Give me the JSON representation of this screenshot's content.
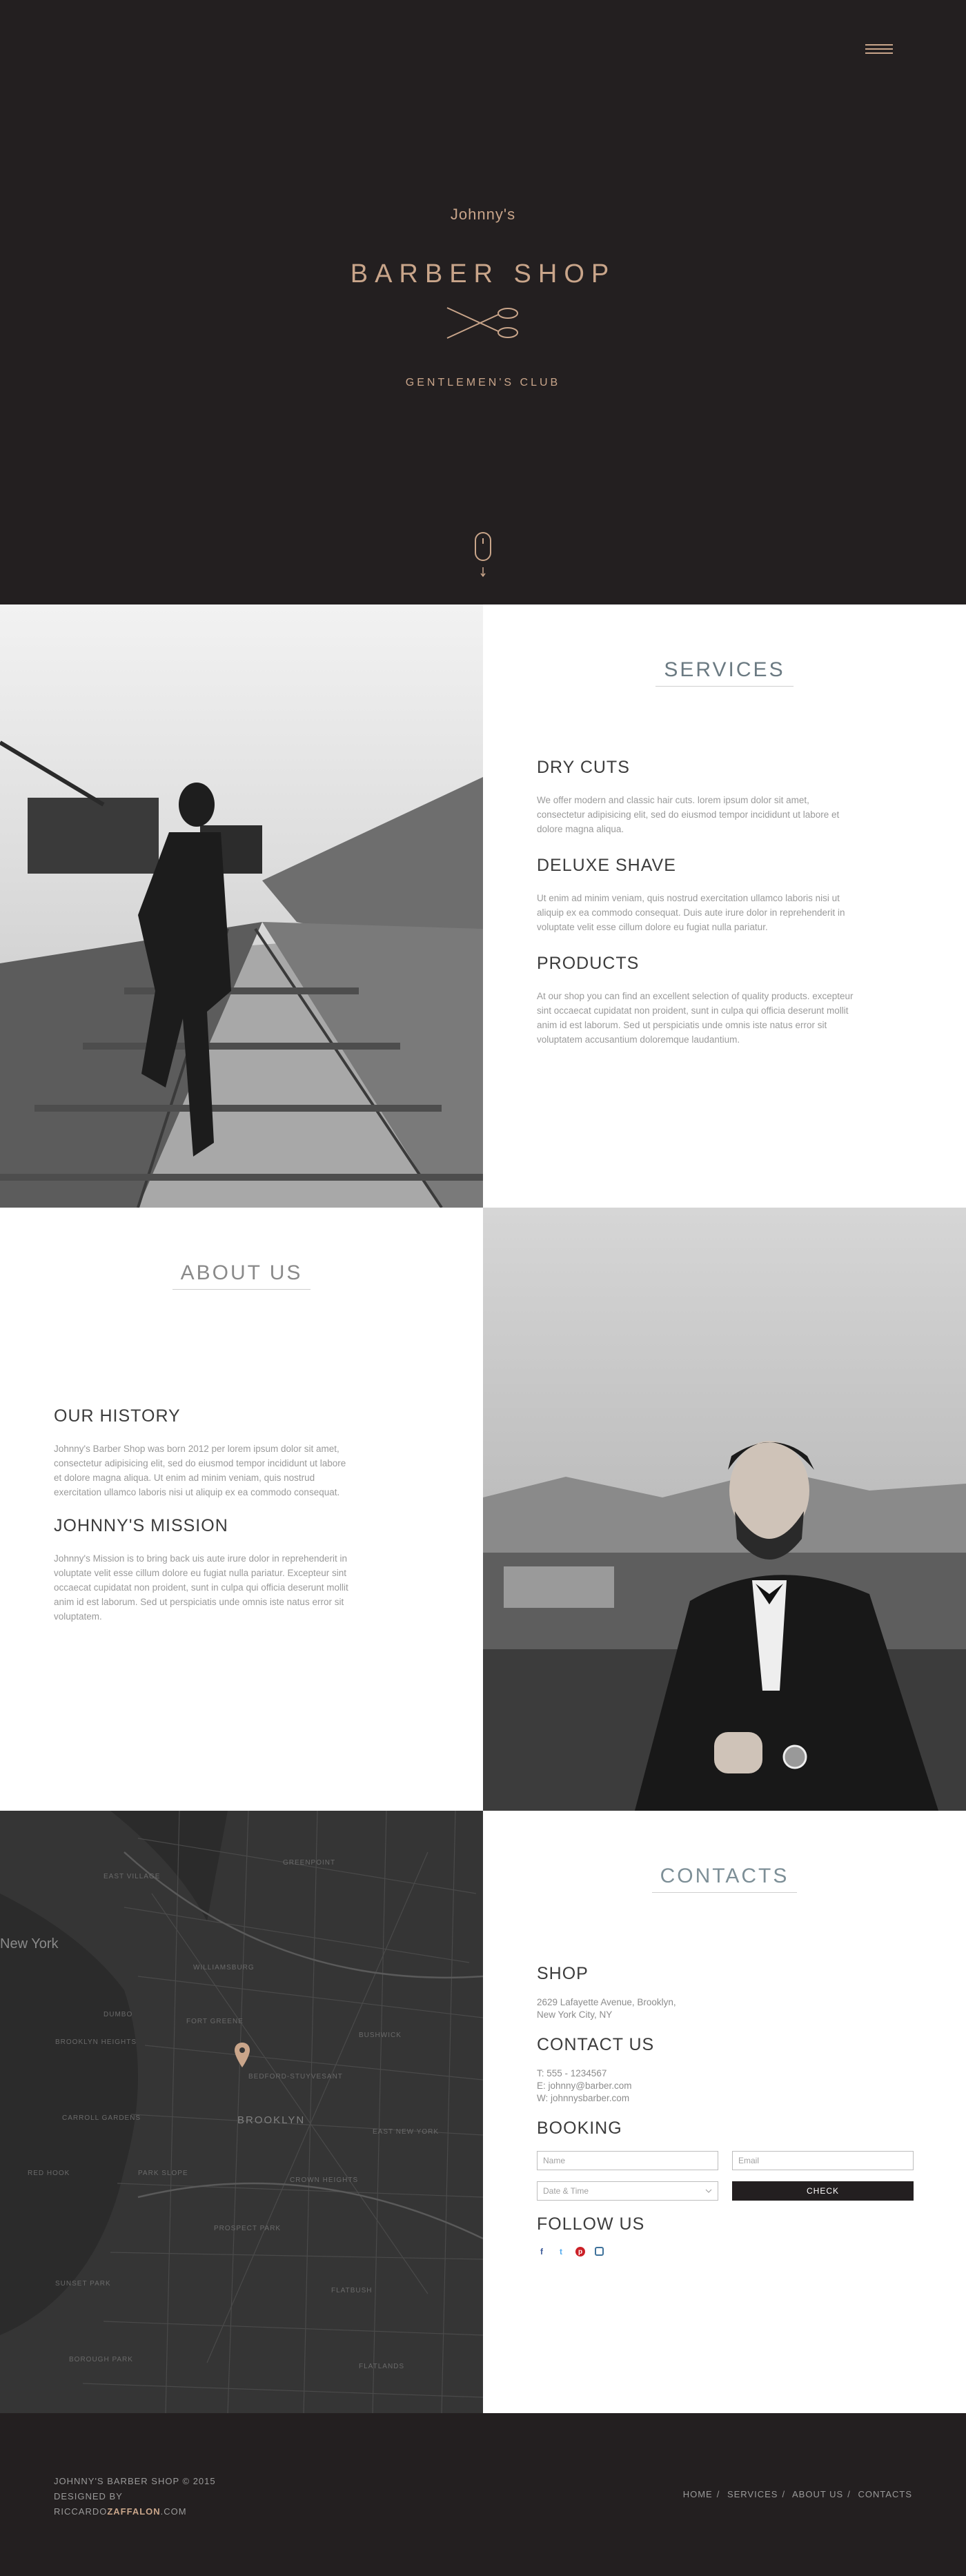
{
  "hero": {
    "subtitle": "Johnny's",
    "title": "BARBER SHOP",
    "tagline": "GENTLEMEN'S CLUB"
  },
  "services": {
    "title": "SERVICES",
    "items": [
      {
        "title": "DRY CUTS",
        "text": "We offer modern and classic hair cuts. lorem ipsum dolor sit amet, consectetur adipisicing elit, sed do eiusmod tempor incididunt ut labore et dolore magna aliqua."
      },
      {
        "title": "DELUXE SHAVE",
        "text": "Ut enim ad minim veniam, quis nostrud exercitation ullamco laboris nisi ut aliquip ex ea commodo consequat. Duis aute irure dolor in reprehenderit in voluptate velit esse cillum dolore eu fugiat nulla pariatur."
      },
      {
        "title": "PRODUCTS",
        "text": "At our shop you can find an excellent selection of quality products. excepteur sint occaecat cupidatat non proident, sunt in culpa qui officia deserunt mollit anim id est laborum. Sed ut perspiciatis unde omnis iste natus error sit voluptatem accusantium doloremque laudantium."
      }
    ]
  },
  "about": {
    "title": "ABOUT US",
    "items": [
      {
        "title": "OUR HISTORY",
        "text": "Johnny's Barber Shop was born 2012 per lorem ipsum dolor sit amet, consectetur adipisicing elit, sed do eiusmod tempor incididunt ut labore et dolore magna aliqua. Ut enim ad minim veniam, quis nostrud exercitation ullamco laboris nisi ut aliquip ex ea commodo consequat."
      },
      {
        "title": "JOHNNY'S MISSION",
        "text": "Johnny's Mission is to bring back uis aute irure dolor in reprehenderit in voluptate velit esse cillum dolore eu fugiat nulla pariatur. Excepteur sint occaecat cupidatat non proident, sunt in culpa qui officia deserunt mollit anim id est laborum. Sed ut perspiciatis unde omnis iste natus error sit voluptatem."
      }
    ]
  },
  "map": {
    "city": "New York",
    "borough": "BROOKLYN",
    "labels": [
      "EAST VILLAGE",
      "GREENPOINT",
      "WILLIAMSBURG",
      "DUMBO",
      "BROOKLYN HEIGHTS",
      "BEDFORD-STUYVESANT",
      "BUSHWICK",
      "CROWN HEIGHTS",
      "PARK SLOPE",
      "FLATBUSH",
      "BOROUGH PARK",
      "SUNSET PARK",
      "RED HOOK",
      "PROSPECT PARK",
      "CARROLL GARDENS",
      "FORT GREENE",
      "EAST NEW YORK",
      "FLATLANDS"
    ]
  },
  "contacts": {
    "title": "CONTACTS",
    "shop": {
      "title": "SHOP",
      "line1": "2629 Lafayette Avenue, Brooklyn,",
      "line2": "New York City, NY"
    },
    "contact": {
      "title": "CONTACT US",
      "phone": "T:  555 - 1234567",
      "email": "E:  johnny@barber.com",
      "web": "W: johnnysbarber.com"
    },
    "booking": {
      "title": "BOOKING",
      "name_placeholder": "Name",
      "email_placeholder": "Email",
      "date_placeholder": "Date & Time",
      "check_label": "CHECK"
    },
    "follow": {
      "title": "FOLLOW US",
      "icons": [
        "facebook-icon",
        "twitter-icon",
        "pinterest-icon",
        "instagram-icon"
      ],
      "colors": [
        "#3b5998",
        "#55acee",
        "#cb2027",
        "#3f729b"
      ]
    }
  },
  "footer": {
    "line1": "JOHNNY'S BARBER SHOP © 2015",
    "line2": "DESIGNED BY",
    "designer_first": "RICCARDO",
    "designer_last": "ZAFFALON",
    "designer_suffix": ".COM",
    "nav": [
      "HOME",
      "SERVICES",
      "ABOUT US",
      "CONTACTS"
    ]
  },
  "colors": {
    "dark": "#231f20",
    "gold": "#c9a58a",
    "white": "#ffffff"
  }
}
